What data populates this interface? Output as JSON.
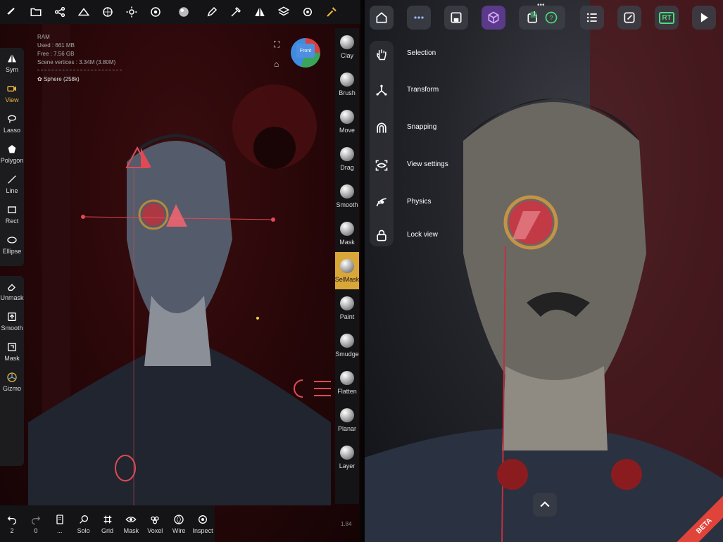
{
  "left_panel": {
    "topbar_icons": [
      "brush-logo-icon",
      "folder-icon",
      "share-icon",
      "scene-icon",
      "sphere-wire-icon",
      "sun-icon",
      "material-icon",
      "matcap-icon",
      "pen-icon",
      "stroke-icon",
      "symmetry-icon",
      "layers-icon",
      "settings-icon",
      "tools-icon"
    ],
    "info": {
      "ram": "RAM",
      "used": "Used : 661 MB",
      "free": "Free : 7.56 GB",
      "vertices": "Scene vertices : 3.34M (3.80M)"
    },
    "mesh_name": "Sphere (258k)",
    "view_cube_label": "Front",
    "left_tools": [
      {
        "label": "Sym",
        "icon": "symmetry-icon"
      },
      {
        "label": "View",
        "icon": "camera-icon",
        "active": true
      },
      {
        "label": "Lasso",
        "icon": "lasso-icon"
      },
      {
        "label": "Polygon",
        "icon": "polygon-icon"
      },
      {
        "label": "Line",
        "icon": "line-icon"
      },
      {
        "label": "Rect",
        "icon": "rect-icon"
      },
      {
        "label": "Ellipse",
        "icon": "ellipse-icon"
      }
    ],
    "left_tools2": [
      {
        "label": "Unmask",
        "icon": "eraser-icon"
      },
      {
        "label": "Smooth",
        "icon": "smooth-icon"
      },
      {
        "label": "Mask",
        "icon": "mask-icon"
      },
      {
        "label": "Gizmo",
        "icon": "gizmo-icon"
      }
    ],
    "brushes": [
      {
        "label": "Clay"
      },
      {
        "label": "Brush"
      },
      {
        "label": "Move"
      },
      {
        "label": "Drag"
      },
      {
        "label": "Smooth"
      },
      {
        "label": "Mask"
      },
      {
        "label": "SelMask",
        "active": true
      },
      {
        "label": "Paint"
      },
      {
        "label": "Smudge"
      },
      {
        "label": "Flatten"
      },
      {
        "label": "Planar"
      },
      {
        "label": "Layer"
      }
    ],
    "bottom": [
      {
        "label": "2",
        "icon": "undo-icon"
      },
      {
        "label": "0",
        "icon": "redo-icon"
      },
      {
        "label": "...",
        "icon": "doc-icon"
      },
      {
        "label": "Solo",
        "icon": "search-icon"
      },
      {
        "label": "Grid",
        "icon": "grid-icon"
      },
      {
        "label": "Mask",
        "icon": "eye-icon"
      },
      {
        "label": "Voxel",
        "icon": "voxel-icon"
      },
      {
        "label": "Wire",
        "icon": "wire-icon"
      },
      {
        "label": "Inspect",
        "icon": "inspect-icon"
      }
    ],
    "version": "1.84"
  },
  "right_panel": {
    "side_items": [
      {
        "label": "Selection",
        "icon": "hand-icon"
      },
      {
        "label": "Transform",
        "icon": "transform-icon"
      },
      {
        "label": "Snapping",
        "icon": "magnet-icon"
      },
      {
        "label": "View settings",
        "icon": "eye-scan-icon"
      },
      {
        "label": "Physics",
        "icon": "physics-icon"
      },
      {
        "label": "Lock view",
        "icon": "lock-icon"
      }
    ],
    "badge_count": "1",
    "rt_label": "RT",
    "beta_label": "BETA"
  }
}
